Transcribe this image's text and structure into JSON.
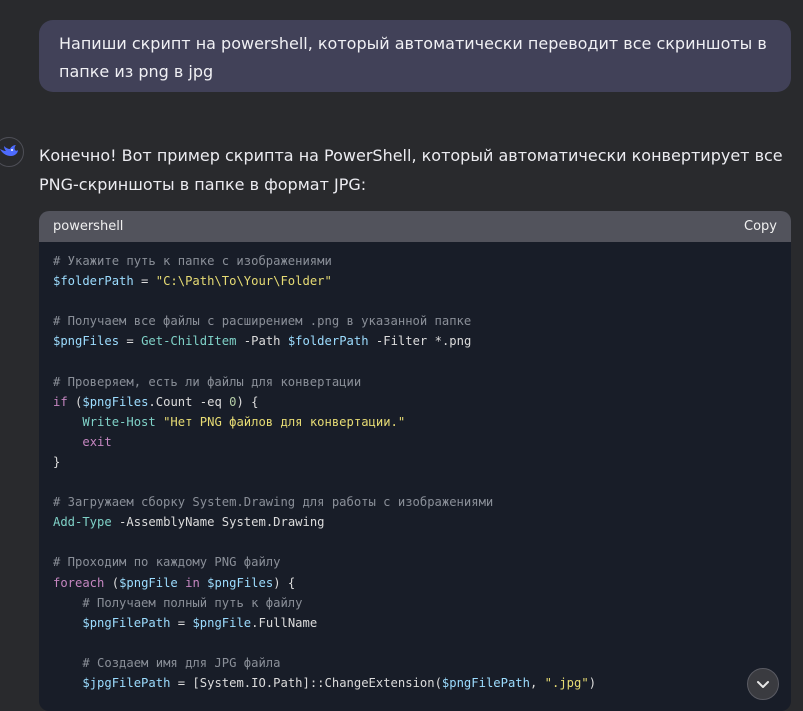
{
  "user_message": "Напиши скрипт на powershell, который автоматически переводит все скриншоты в папке из png в jpg",
  "assistant": {
    "intro": "Конечно! Вот пример скрипта на PowerShell, который автоматически конвертирует все PNG-скриншоты в папке в формат JPG:",
    "avatar_icon": "whale-logo-icon"
  },
  "code_block": {
    "language": "powershell",
    "copy_label": "Copy",
    "lines": [
      [
        [
          "cmt",
          "# Укажите путь к папке с изображениями"
        ]
      ],
      [
        [
          "var",
          "$folderPath"
        ],
        [
          "op",
          " = "
        ],
        [
          "str2",
          "\"C:\\Path\\To\\Your\\Folder\""
        ]
      ],
      [],
      [
        [
          "cmt",
          "# Получаем все файлы с расширением .png в указанной папке"
        ]
      ],
      [
        [
          "var",
          "$pngFiles"
        ],
        [
          "op",
          " = "
        ],
        [
          "cmd",
          "Get-ChildItem"
        ],
        [
          "op",
          " -"
        ],
        [
          "prm",
          "Path "
        ],
        [
          "var",
          "$folderPath"
        ],
        [
          "op",
          " -"
        ],
        [
          "prm",
          "Filter "
        ],
        [
          "op",
          "*."
        ],
        [
          "prm",
          "png"
        ]
      ],
      [],
      [
        [
          "cmt",
          "# Проверяем, есть ли файлы для конвертации"
        ]
      ],
      [
        [
          "kw",
          "if"
        ],
        [
          "op",
          " ("
        ],
        [
          "var",
          "$pngFiles"
        ],
        [
          "op",
          "."
        ],
        [
          "prm",
          "Count"
        ],
        [
          "op",
          " -eq "
        ],
        [
          "num",
          "0"
        ],
        [
          "op",
          ") {"
        ]
      ],
      [
        [
          "op",
          "    "
        ],
        [
          "cmd",
          "Write-Host"
        ],
        [
          "op",
          " "
        ],
        [
          "str2",
          "\"Нет PNG файлов для конвертации.\""
        ]
      ],
      [
        [
          "op",
          "    "
        ],
        [
          "kw",
          "exit"
        ]
      ],
      [
        [
          "op",
          "}"
        ]
      ],
      [],
      [
        [
          "cmt",
          "# Загружаем сборку System.Drawing для работы с изображениями"
        ]
      ],
      [
        [
          "cmd",
          "Add-Type"
        ],
        [
          "op",
          " -"
        ],
        [
          "prm",
          "AssemblyName System"
        ],
        [
          "op",
          "."
        ],
        [
          "prm",
          "Drawing"
        ]
      ],
      [],
      [
        [
          "cmt",
          "# Проходим по каждому PNG файлу"
        ]
      ],
      [
        [
          "kw",
          "foreach"
        ],
        [
          "op",
          " ("
        ],
        [
          "var",
          "$pngFile"
        ],
        [
          "op",
          " "
        ],
        [
          "kw",
          "in"
        ],
        [
          "op",
          " "
        ],
        [
          "var",
          "$pngFiles"
        ],
        [
          "op",
          ") {"
        ]
      ],
      [
        [
          "op",
          "    "
        ],
        [
          "cmt",
          "# Получаем полный путь к файлу"
        ]
      ],
      [
        [
          "op",
          "    "
        ],
        [
          "var",
          "$pngFilePath"
        ],
        [
          "op",
          " = "
        ],
        [
          "var",
          "$pngFile"
        ],
        [
          "op",
          "."
        ],
        [
          "prm",
          "FullName"
        ]
      ],
      [],
      [
        [
          "op",
          "    "
        ],
        [
          "cmt",
          "# Создаем имя для JPG файла"
        ]
      ],
      [
        [
          "op",
          "    "
        ],
        [
          "var",
          "$jpgFilePath"
        ],
        [
          "op",
          " = [System.IO.Path]::"
        ],
        [
          "prm",
          "ChangeExtension"
        ],
        [
          "op",
          "("
        ],
        [
          "var",
          "$pngFilePath"
        ],
        [
          "op",
          ", "
        ],
        [
          "str2",
          "\".jpg\""
        ],
        [
          "op",
          ")"
        ]
      ]
    ]
  },
  "scroll_button_icon": "chevron-down-icon"
}
